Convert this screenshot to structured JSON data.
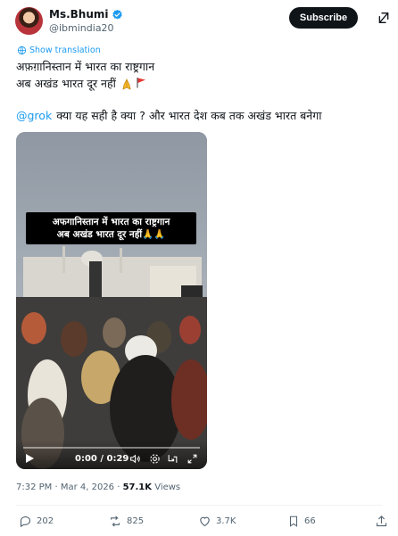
{
  "author": {
    "name": "Ms.Bhumi",
    "handle": "@ibmindia20"
  },
  "header": {
    "subscribe_label": "Subscribe"
  },
  "tweet": {
    "show_translation": "Show translation",
    "line1": "अफ़ग़ानिस्तान में भारत का राष्ट्रगान",
    "line2": "अब अखंड भारत दूर नहीं",
    "mention": "@grok",
    "line3": "क्या यह सही है क्या ? और भारत देश कब तक अखंड भारत बनेगा"
  },
  "video": {
    "caption_line1": "अफगानिस्तान में भारत का राष्ट्रगान",
    "caption_line2": "अब अखंड भारत दूर नहीं🙏🙏",
    "time": "0:00 / 0:29",
    "progress": 0
  },
  "meta": {
    "timestamp": "7:32 PM · Mar 4, 2026 · ",
    "views_count": "57.1K",
    "views_label": " Views"
  },
  "actions": {
    "replies": "202",
    "reposts": "825",
    "likes": "3.7K",
    "bookmarks": "66"
  },
  "colors": {
    "accent": "#1d9bf0",
    "verified": "#1d9bf0",
    "text": "#0f1419",
    "muted": "#536471"
  }
}
